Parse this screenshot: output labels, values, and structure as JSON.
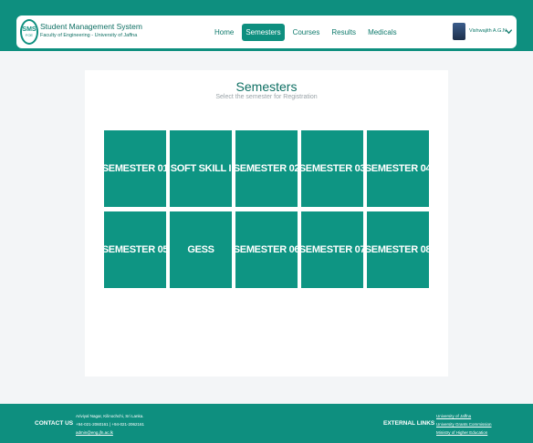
{
  "header": {
    "logo_text": "SMS",
    "logo_sub": "FOE",
    "brand_title": "Student Management System",
    "brand_subtitle": "Faculty of Engineering - University of Jaffna",
    "nav": [
      "Home",
      "Semesters",
      "Courses",
      "Results",
      "Medicals"
    ],
    "active_nav": "Semesters",
    "user_name": "Vishwajith A.G.N",
    "user_menu_icon": "chevron-down-icon"
  },
  "main": {
    "title": "Semesters",
    "subtitle": "Select the semester for Registration",
    "tiles": [
      "SEMESTER 01",
      "SOFT SKILL I",
      "SEMESTER 02",
      "SEMESTER 03",
      "SEMESTER 04",
      "SEMESTER 05",
      "GESS",
      "SEMESTER 06",
      "SEMESTER 07",
      "SEMESTER 08"
    ]
  },
  "footer": {
    "contact_label": "CONTACT US",
    "contact_lines": [
      "Ariviyal Nagar, Kilinochchi, Sri Lanka.",
      "+94-021-2060161 | +94-021-2062161",
      "admin@eng.jfn.ac.lk"
    ],
    "external_label": "EXTERNAL LINKS",
    "external_links": [
      "University of Jaffna",
      "University Grants Commission",
      "Ministry of Higher Education"
    ]
  },
  "colors": {
    "primary": "#0e8f7f",
    "tile": "#0e9583",
    "page_bg": "#f3f5f7"
  }
}
